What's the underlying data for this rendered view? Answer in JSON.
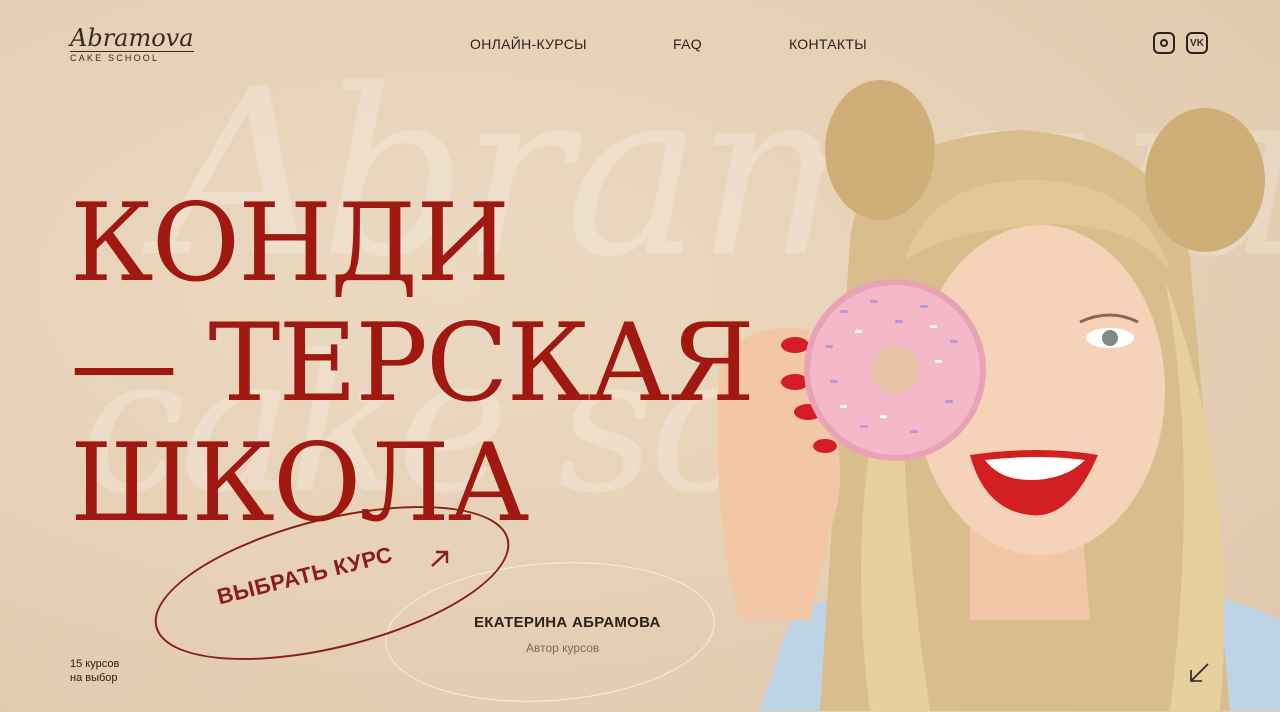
{
  "brand": {
    "script": "Abramova",
    "sub": "CAKE SCHOOL"
  },
  "nav": [
    {
      "label": "ОНЛАЙН-КУРСЫ"
    },
    {
      "label": "FAQ"
    },
    {
      "label": "КОНТАКТЫ"
    }
  ],
  "social": {
    "instagram_icon": "instagram-icon",
    "vk_label": "VK"
  },
  "hero": {
    "line1": "КОНДИ",
    "line2": "— ТЕРСКАЯ",
    "line3": "ШКОЛА"
  },
  "cta": {
    "label": "ВЫБРАТЬ КУРС",
    "icon": "arrow-up-right-icon"
  },
  "author": {
    "name": "ЕКАТЕРИНА АБРАМОВА",
    "role": "Автор курсов"
  },
  "courses": {
    "line1": "15 курсов",
    "line2": "на выбор"
  },
  "scroll": {
    "icon": "arrow-down-left-icon"
  },
  "colors": {
    "accent": "#a01810",
    "background": "#e6d0b5",
    "text": "#2c211c"
  }
}
